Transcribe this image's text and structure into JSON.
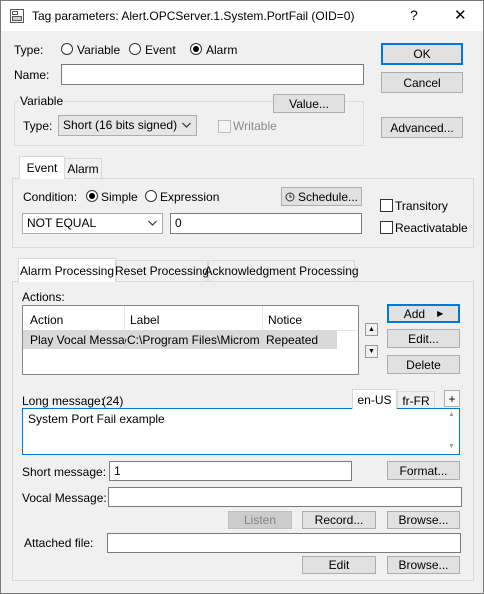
{
  "window": {
    "title": "Tag parameters: Alert.OPCServer.1.System.PortFail (OID=0)",
    "help": "?",
    "close": "✕"
  },
  "type_row": {
    "label": "Type:",
    "options": [
      "Variable",
      "Event",
      "Alarm"
    ],
    "selected": "Alarm"
  },
  "name": {
    "label": "Name:",
    "value": ""
  },
  "variable": {
    "group_label": "Variable",
    "value_button": "Value...",
    "type_label": "Type:",
    "type_value": "Short (16 bits signed)",
    "writable_label": "Writable"
  },
  "right_buttons": {
    "ok": "OK",
    "cancel": "Cancel",
    "advanced": "Advanced..."
  },
  "event_tabs": [
    "Event",
    "Alarm"
  ],
  "event": {
    "condition_label": "Condition:",
    "condition_options": [
      "Simple",
      "Expression"
    ],
    "condition_selected": "Simple",
    "schedule_button": "Schedule...",
    "operator_value": "NOT EQUAL",
    "threshold_value": "0",
    "transitory_label": "Transitory",
    "reactivatable_label": "Reactivatable"
  },
  "processing_tabs": [
    "Alarm Processing",
    "Reset Processing",
    "Acknowledgment Processing"
  ],
  "actions": {
    "label": "Actions:",
    "columns": [
      "Action",
      "Label",
      "Notice"
    ],
    "rows": [
      {
        "action": "Play Vocal Message",
        "label": "C:\\Program Files\\Microm...",
        "notice": "Repeated"
      }
    ],
    "add_button": "Add",
    "edit_button": "Edit...",
    "delete_button": "Delete"
  },
  "long_message": {
    "label": "Long message:",
    "count": "(24)",
    "lang_tabs": [
      "en-US",
      "fr-FR"
    ],
    "add_lang": "+",
    "value": "System Port Fail example"
  },
  "short_message": {
    "label": "Short message:",
    "value": "1",
    "format_button": "Format..."
  },
  "vocal_message": {
    "label": "Vocal Message:",
    "value": "",
    "listen_button": "Listen",
    "record_button": "Record...",
    "browse_button": "Browse..."
  },
  "attached_file": {
    "label": "Attached file:",
    "value": "",
    "edit_button": "Edit",
    "browse_button": "Browse..."
  }
}
